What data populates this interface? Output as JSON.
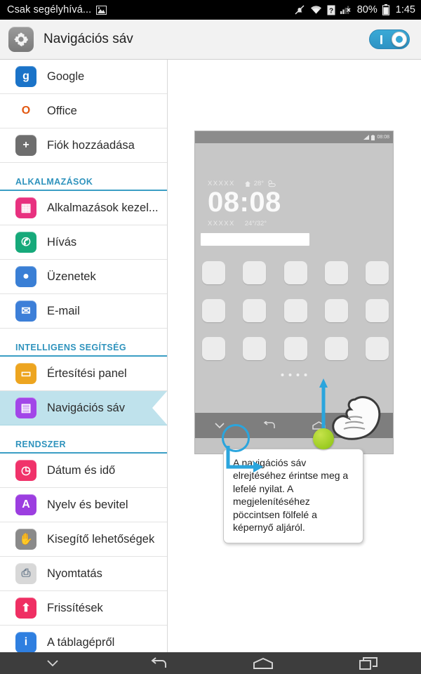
{
  "statusbar": {
    "carrier": "Csak segélyhívá...",
    "screenshot_icon": "image-icon",
    "mute_icon": "mute-bell-icon",
    "wifi_icon": "wifi-icon",
    "sim_icon": "sim-question-icon",
    "signal_icon": "signal-no-service-icon",
    "battery_percent": "80%",
    "battery_icon": "battery-icon",
    "time": "1:45"
  },
  "header": {
    "icon": "gear-icon",
    "title": "Navigációs sáv",
    "toggle_state": "on",
    "toggle_color": "#33a3d1"
  },
  "sidebar": {
    "accent_color": "#2f93bd",
    "selected_bg": "#bfe2ec",
    "items": [
      {
        "type": "item",
        "label": "Google",
        "icon": "google-icon",
        "color": "#1a73c8",
        "glyph": "g"
      },
      {
        "type": "item",
        "label": "Office",
        "icon": "office-icon",
        "color": "#ffffff",
        "glyph": "O"
      },
      {
        "type": "item",
        "label": "Fiók hozzáadása",
        "icon": "add-account-icon",
        "color": "#6e6e6e",
        "glyph": "+"
      },
      {
        "type": "section",
        "label": "ALKALMAZÁSOK"
      },
      {
        "type": "item",
        "label": "Alkalmazások kezel...",
        "icon": "app-manager-icon",
        "color": "#e8317f",
        "glyph": "▦"
      },
      {
        "type": "item",
        "label": "Hívás",
        "icon": "phone-icon",
        "color": "#16a97a",
        "glyph": "✆"
      },
      {
        "type": "item",
        "label": "Üzenetek",
        "icon": "messages-icon",
        "color": "#3a7fd5",
        "glyph": "●"
      },
      {
        "type": "item",
        "label": "E-mail",
        "icon": "email-icon",
        "color": "#3d7fd8",
        "glyph": "✉"
      },
      {
        "type": "section",
        "label": "INTELLIGENS SEGÍTSÉG"
      },
      {
        "type": "item",
        "label": "Értesítési panel",
        "icon": "notification-panel-icon",
        "color": "#eda520",
        "glyph": "▭"
      },
      {
        "type": "item",
        "label": "Navigációs sáv",
        "icon": "navigation-bar-icon",
        "color": "#a246e8",
        "glyph": "▤",
        "selected": true
      },
      {
        "type": "section",
        "label": "RENDSZER"
      },
      {
        "type": "item",
        "label": "Dátum és idő",
        "icon": "clock-icon",
        "color": "#f0326a",
        "glyph": "◷"
      },
      {
        "type": "item",
        "label": "Nyelv és bevitel",
        "icon": "language-icon",
        "color": "#9c3ee0",
        "glyph": "A"
      },
      {
        "type": "item",
        "label": "Kisegítő lehetőségek",
        "icon": "hand-icon",
        "color": "#8a8a8a",
        "glyph": "✋"
      },
      {
        "type": "item",
        "label": "Nyomtatás",
        "icon": "printer-icon",
        "color": "#d8d8d8",
        "glyph": "⎙"
      },
      {
        "type": "item",
        "label": "Frissítések",
        "icon": "updates-icon",
        "color": "#ef2f63",
        "glyph": "⬆"
      },
      {
        "type": "item",
        "label": "A táblagépről",
        "icon": "info-icon",
        "color": "#2f7fe0",
        "glyph": "i"
      }
    ]
  },
  "preview": {
    "phone_status_time": "08:08",
    "widget": {
      "city": "XXXXX",
      "home_icon": "home-icon",
      "current_temp": "28°",
      "weather_icon": "partly-cloudy-icon",
      "clock": "08:08",
      "city2": "XXXXX",
      "temp_range": "24°/32°"
    },
    "search_placeholder": "",
    "app_rows": 3,
    "app_cols": 5,
    "page_dots": 4,
    "nav_icons": [
      "chevron-down-icon",
      "back-icon",
      "home-icon",
      "recents-icon"
    ],
    "gesture": {
      "hand_icon": "hand-swipe-icon",
      "touch_indicator": "green-touch-dot",
      "arrow": "up-arrow",
      "arrow_color": "#2ba5dd",
      "highlight_color": "#2ba5dd"
    },
    "tooltip": "A navigációs sáv elrejtéséhez érintse meg a lefelé nyilat. A megjelenítéséhez pöccintsen fölfelé a képernyő aljáról."
  },
  "navbar": {
    "items": [
      {
        "icon": "chevron-down-icon",
        "name": "hide-navbar-button"
      },
      {
        "icon": "back-icon",
        "name": "back-button"
      },
      {
        "icon": "home-icon",
        "name": "home-button"
      },
      {
        "icon": "recents-icon",
        "name": "recents-button"
      }
    ]
  }
}
